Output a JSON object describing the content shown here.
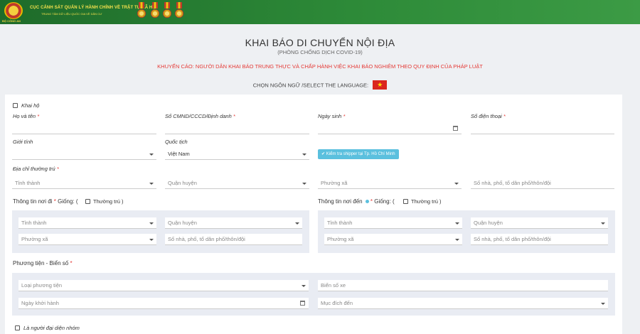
{
  "header": {
    "title": "CỤC CẢNH SÁT QUẢN LÝ HÀNH CHÍNH VỀ TRẬT TỰ XÃ HỘI",
    "subtitle": "TRUNG TÂM DỮ LIỆU QUỐC GIA VỀ DÂN CƯ",
    "emblem_label": "BỘ CÔNG AN"
  },
  "page": {
    "title": "KHAI BÁO DI CHUYỂN NỘI ĐỊA",
    "subtitle": "(PHÒNG CHỐNG DỊCH COVID-19)",
    "warning": "KHUYẾN CÁO: NGƯỜI DÂN KHAI BÁO TRUNG THỰC VÀ CHẤP HÀNH VIỆC KHAI BÁO NGHIÊM THEO QUY ĐỊNH CỦA PHÁP LUẬT",
    "language_label": "CHỌN NGÔN NGỮ /SELECT THE LANGUAGE:",
    "flag_star": "★"
  },
  "form": {
    "khai_ho": "Khai hộ",
    "ho_ten": "Họ và tên",
    "cmnd": "Số CMND/CCCD/Định danh",
    "ngay_sinh": "Ngày sinh",
    "so_dien_thoai": "Số điện thoại",
    "gioi_tinh": "Giới tính",
    "quoc_tich": "Quốc tịch",
    "quoc_tich_value": "Việt Nam",
    "check_button": "✔ Kiểm tra shipper tại Tp. Hồ Chí Minh",
    "dia_chi": "Địa chỉ thường trú",
    "req": "*",
    "tinh_thanh": "Tỉnh thành",
    "quan_huyen": "Quận huyện",
    "phuong_xa": "Phường xã",
    "so_nha": "Số nhà, phố, tổ dân phố/thôn/đội",
    "noi_di": "Thông tin nơi đi",
    "noi_den": "Thông tin nơi đến",
    "giong_open": "Giống: (",
    "thuong_tru": "Thường trú",
    "close_paren": ")",
    "phuong_tien": "Phương tiện - Biển số",
    "loai_phuong_tien": "Loại phương tiện",
    "bien_so": "Biển số xe",
    "ngay_khoi_hanh": "Ngày khởi hành",
    "muc_dich_den": "Mục đích đến",
    "dai_dien": "Là người đại diện nhóm"
  },
  "colors": {
    "header_green": "#2d8a38",
    "warning_red": "#e53935",
    "button_blue": "#5bc0de"
  }
}
